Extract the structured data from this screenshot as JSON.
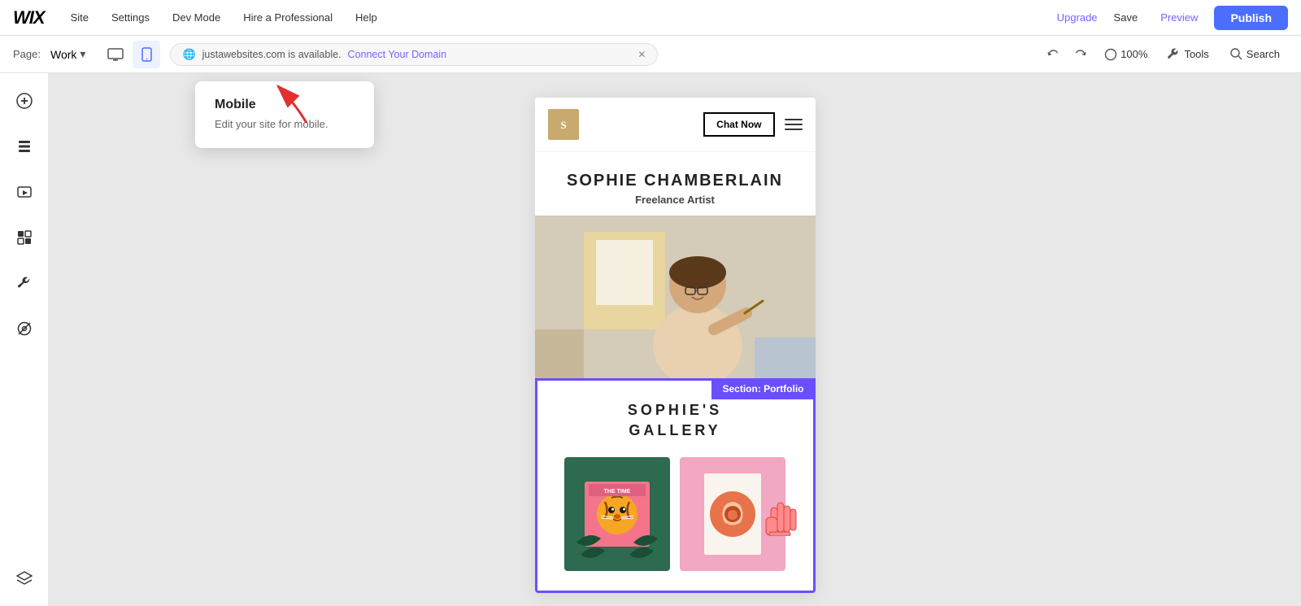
{
  "topbar": {
    "logo": "WIX",
    "nav": [
      {
        "label": "Site"
      },
      {
        "label": "Settings"
      },
      {
        "label": "Dev Mode"
      },
      {
        "label": "Hire a Professional"
      },
      {
        "label": "Help"
      }
    ],
    "upgrade_label": "Upgrade",
    "save_label": "Save",
    "preview_label": "Preview",
    "publish_label": "Publish"
  },
  "secondbar": {
    "page_label": "Page:",
    "page_name": "Work",
    "zoom": "100%",
    "tools_label": "Tools",
    "search_label": "Search",
    "domain_text": "justawebsites.com is available.",
    "connect_label": "Connect Your Domain"
  },
  "tooltip": {
    "title": "Mobile",
    "description": "Edit your site for mobile."
  },
  "site": {
    "header": {
      "chat_now": "Chat Now"
    },
    "hero": {
      "name": "SOPHIE CHAMBERLAIN",
      "subtitle": "Freelance Artist"
    },
    "section_label": "Section: Portfolio",
    "portfolio": {
      "title": "SOPHIE'S\nGALLERY"
    }
  },
  "icons": {
    "add": "+",
    "layers": "☰",
    "media": "◼",
    "wrench": "🔧",
    "eye_off": "◎",
    "pages_icon": "⊞",
    "undo": "↩",
    "redo": "↪",
    "zoom_icon": "○",
    "tools_icon": "🔧",
    "search_icon": "🔍",
    "desktop_icon": "🖥",
    "mobile_icon": "📱",
    "globe_icon": "🌐"
  }
}
